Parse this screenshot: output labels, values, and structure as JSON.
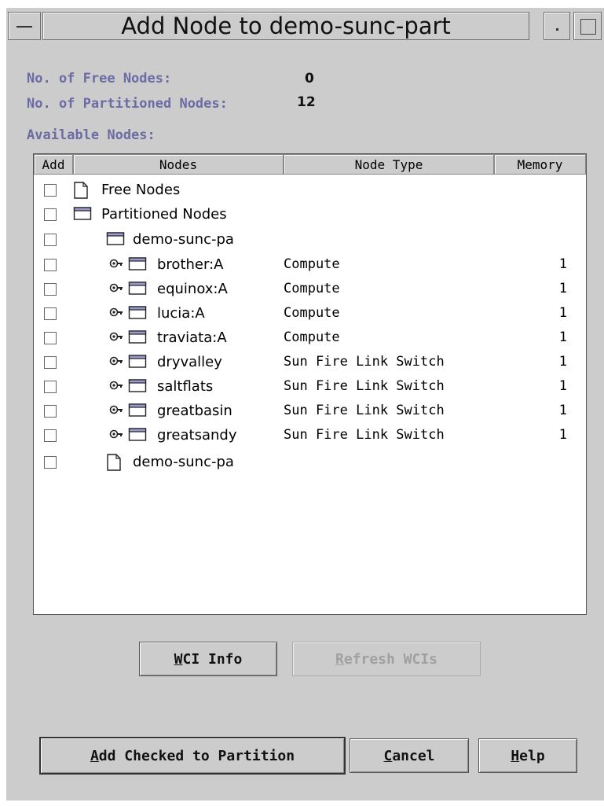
{
  "window": {
    "title": "Add Node to demo-sunc-part"
  },
  "summary": {
    "free_label": "No. of Free Nodes:",
    "free_value": "0",
    "partitioned_label": "No. of Partitioned Nodes:",
    "partitioned_value": "12",
    "available_label": "Available Nodes:"
  },
  "table": {
    "columns": [
      "Add",
      "Nodes",
      "Node Type",
      "Memory"
    ],
    "rows": [
      {
        "icon": "document-icon",
        "name": "Free Nodes",
        "type": "",
        "memory": ""
      },
      {
        "icon": "folder-icon",
        "name": "Partitioned Nodes",
        "type": "",
        "memory": ""
      },
      {
        "icon": "folder-icon",
        "name": "demo-sunc-pa",
        "type": "",
        "memory": ""
      },
      {
        "icon": "key-folder-icon",
        "name": "brother:A",
        "type": "Compute",
        "memory": "1"
      },
      {
        "icon": "key-folder-icon",
        "name": "equinox:A",
        "type": "Compute",
        "memory": "1"
      },
      {
        "icon": "key-folder-icon",
        "name": "lucia:A",
        "type": "Compute",
        "memory": "1"
      },
      {
        "icon": "key-folder-icon",
        "name": "traviata:A",
        "type": "Compute",
        "memory": "1"
      },
      {
        "icon": "key-folder-icon",
        "name": "dryvalley",
        "type": "Sun Fire Link Switch",
        "memory": "1"
      },
      {
        "icon": "key-folder-icon",
        "name": "saltflats",
        "type": "Sun Fire Link Switch",
        "memory": "1"
      },
      {
        "icon": "key-folder-icon",
        "name": "greatbasin",
        "type": "Sun Fire Link Switch",
        "memory": "1"
      },
      {
        "icon": "key-folder-icon",
        "name": "greatsandy",
        "type": "Sun Fire Link Switch",
        "memory": "1"
      },
      {
        "icon": "document-icon",
        "name": "demo-sunc-pa",
        "type": "",
        "memory": ""
      }
    ]
  },
  "buttons": {
    "wci_info": {
      "mnemonic": "W",
      "rest": "CI Info"
    },
    "refresh_wcis": {
      "mnemonic": "R",
      "rest": "efresh WCIs"
    },
    "add_checked": {
      "mnemonic": "A",
      "rest": "dd Checked to Partition"
    },
    "cancel": {
      "mnemonic": "C",
      "rest": "ancel"
    },
    "help": {
      "mnemonic": "H",
      "rest": "elp"
    }
  }
}
